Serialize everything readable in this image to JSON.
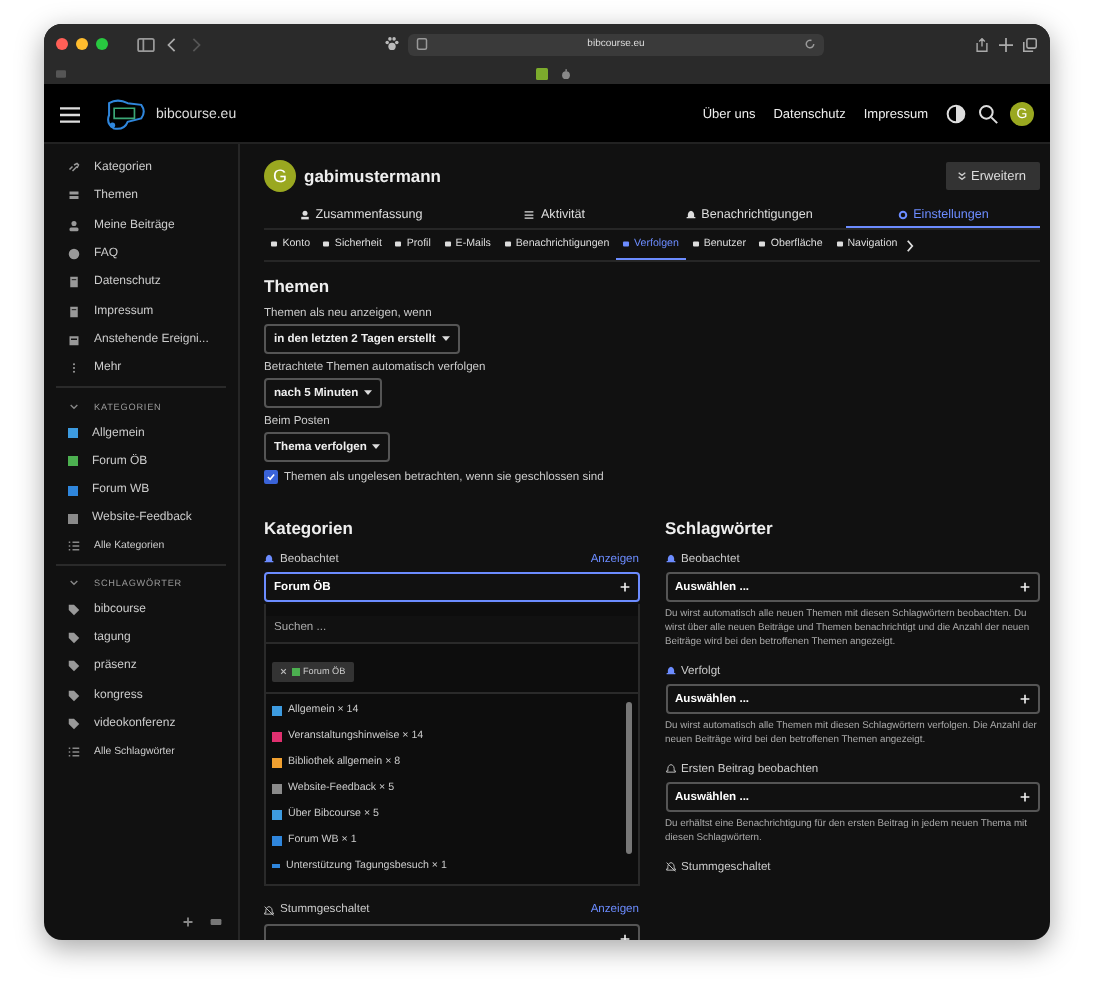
{
  "browser": {
    "url": "bibcourse.eu"
  },
  "site_header": {
    "title": "bibcourse.eu",
    "links": [
      "Über uns",
      "Datenschutz",
      "Impressum"
    ],
    "avatar": "G"
  },
  "sidebar": {
    "items": [
      "Kategorien",
      "Themen",
      "Meine Beiträge",
      "FAQ",
      "Datenschutz",
      "Impressum",
      "Anstehende Ereigni...",
      "Mehr"
    ],
    "sections": [
      {
        "title": "KATEGORIEN",
        "expanded": true,
        "items": [
          {
            "label": "Allgemein",
            "color": "#3d9be0"
          },
          {
            "label": "Forum ÖB",
            "color": "#4cb050"
          },
          {
            "label": "Forum WB",
            "color": "#2f86dc"
          },
          {
            "label": "Website-Feedback",
            "color": "#8a8a8a"
          }
        ],
        "all_link": "Alle Kategorien"
      },
      {
        "title": "SCHLAGWÖRTER",
        "expanded": true,
        "items": [
          {
            "label": "bibcourse"
          },
          {
            "label": "tagung"
          },
          {
            "label": "präsenz"
          },
          {
            "label": "kongress"
          },
          {
            "label": "videokonferenz"
          }
        ],
        "all_link": "Alle Schlagwörter"
      }
    ]
  },
  "profile": {
    "avatar": "G",
    "username": "gabimustermann",
    "expand_button": "Erweitern"
  },
  "tabs": [
    {
      "label": "Zusammenfassung",
      "selected": false
    },
    {
      "label": "Aktivität",
      "selected": false
    },
    {
      "label": "Benachrichtigungen",
      "selected": false
    },
    {
      "label": "Einstellungen",
      "selected": true
    }
  ],
  "subtabs": [
    {
      "label": "Konto",
      "selected": false
    },
    {
      "label": "Sicherheit",
      "selected": false
    },
    {
      "label": "Profil",
      "selected": false
    },
    {
      "label": "E-Mails",
      "selected": false
    },
    {
      "label": "Benachrichtigungen",
      "selected": false
    },
    {
      "label": "Verfolgen",
      "selected": true
    },
    {
      "label": "Benutzer",
      "selected": false
    },
    {
      "label": "Oberfläche",
      "selected": false
    },
    {
      "label": "Navigation",
      "selected": false
    }
  ],
  "themen": {
    "title": "Themen",
    "settings": [
      {
        "label": "Themen als neu anzeigen, wenn",
        "value": "in den letzten 2 Tagen erstellt"
      },
      {
        "label": "Betrachtete Themen automatisch verfolgen",
        "value": "nach 5 Minuten"
      },
      {
        "label": "Beim Posten",
        "value": "Thema verfolgen"
      }
    ],
    "checkbox": {
      "label": "Themen als ungelesen betrachten, wenn sie geschlossen sind",
      "checked": true
    }
  },
  "kategorien": {
    "title": "Kategorien",
    "watched": {
      "label": "Beobachtet",
      "link": "Anzeigen",
      "value": "Forum ÖB",
      "focused": true
    },
    "dropdown": {
      "search_placeholder": "Suchen ...",
      "chips": [
        {
          "label": "Forum ÖB",
          "color": "#4cb050"
        }
      ],
      "options": [
        {
          "kind": "category",
          "label": "Allgemein × 14",
          "color": "#3d9be0"
        },
        {
          "kind": "category",
          "label": "Veranstaltungshinweise × 14",
          "color": "#e0306f"
        },
        {
          "kind": "category",
          "label": "Bibliothek allgemein × 8",
          "color": "#f0a030"
        },
        {
          "kind": "category",
          "label": "Website-Feedback × 5",
          "color": "#8a8a8a"
        },
        {
          "kind": "category",
          "label": "Über Bibcourse × 5",
          "color": "#3d9be0"
        },
        {
          "kind": "category",
          "label": "Forum WB × 1",
          "color": "#2f86dc"
        },
        {
          "kind": "subcategory",
          "label": "Unterstützung Tagungsbesuch × 1",
          "color": "#2f86dc"
        }
      ]
    },
    "muted": {
      "label": "Stummgeschaltet",
      "link": "Anzeigen"
    }
  },
  "schlagwoerter": {
    "title": "Schlagwörter",
    "groups": [
      {
        "label": "Beobachtet",
        "prompt": "Auswählen ...",
        "description": "Du wirst automatisch alle neuen Themen mit diesen Schlagwörtern beobachten. Du wirst über alle neuen Beiträge und Themen benachrichtigt und die Anzahl der neuen Beiträge wird bei den betroffenen Themen angezeigt."
      },
      {
        "label": "Verfolgt",
        "prompt": "Auswählen ...",
        "description": "Du wirst automatisch alle Themen mit diesen Schlagwörtern verfolgen. Die Anzahl der neuen Beiträge wird bei den betroffenen Themen angezeigt."
      },
      {
        "label": "Ersten Beitrag beobachten",
        "prompt": "Auswählen ...",
        "description": "Du erhältst eine Benachrichtigung für den ersten Beitrag in jedem neuen Thema mit diesen Schlagwörtern."
      },
      {
        "label": "Stummgeschaltet"
      }
    ]
  }
}
